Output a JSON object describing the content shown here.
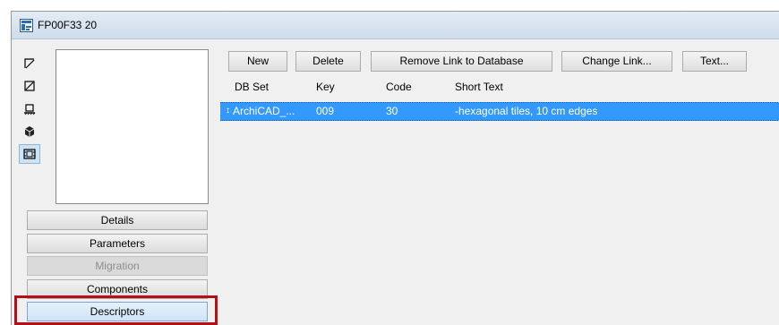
{
  "window": {
    "title": "FP00F33 20"
  },
  "sidebar": {
    "icons": [
      {
        "name": "floor-plan-icon"
      },
      {
        "name": "section-icon"
      },
      {
        "name": "elevation-icon"
      },
      {
        "name": "3d-icon"
      },
      {
        "name": "descriptor-view-icon"
      }
    ],
    "nav": [
      {
        "label": "Details",
        "state": "normal"
      },
      {
        "label": "Parameters",
        "state": "normal"
      },
      {
        "label": "Migration",
        "state": "disabled"
      },
      {
        "label": "Components",
        "state": "normal"
      },
      {
        "label": "Descriptors",
        "state": "selected"
      }
    ]
  },
  "toolbar": {
    "new_label": "New",
    "delete_label": "Delete",
    "remove_link_label": "Remove Link to Database",
    "change_link_label": "Change Link...",
    "text_label": "Text..."
  },
  "table": {
    "columns": [
      "DB Set",
      "Key",
      "Code",
      "Short Text"
    ],
    "rows": [
      {
        "marker": "↕",
        "db_set": "ArchiCAD_...",
        "key": "009",
        "code": "30",
        "short_text": "-hexagonal tiles, 10 cm edges"
      }
    ]
  },
  "colors": {
    "selection": "#3399ff",
    "highlight_frame": "#b3101a",
    "titlebar": "#d7e2ef"
  }
}
